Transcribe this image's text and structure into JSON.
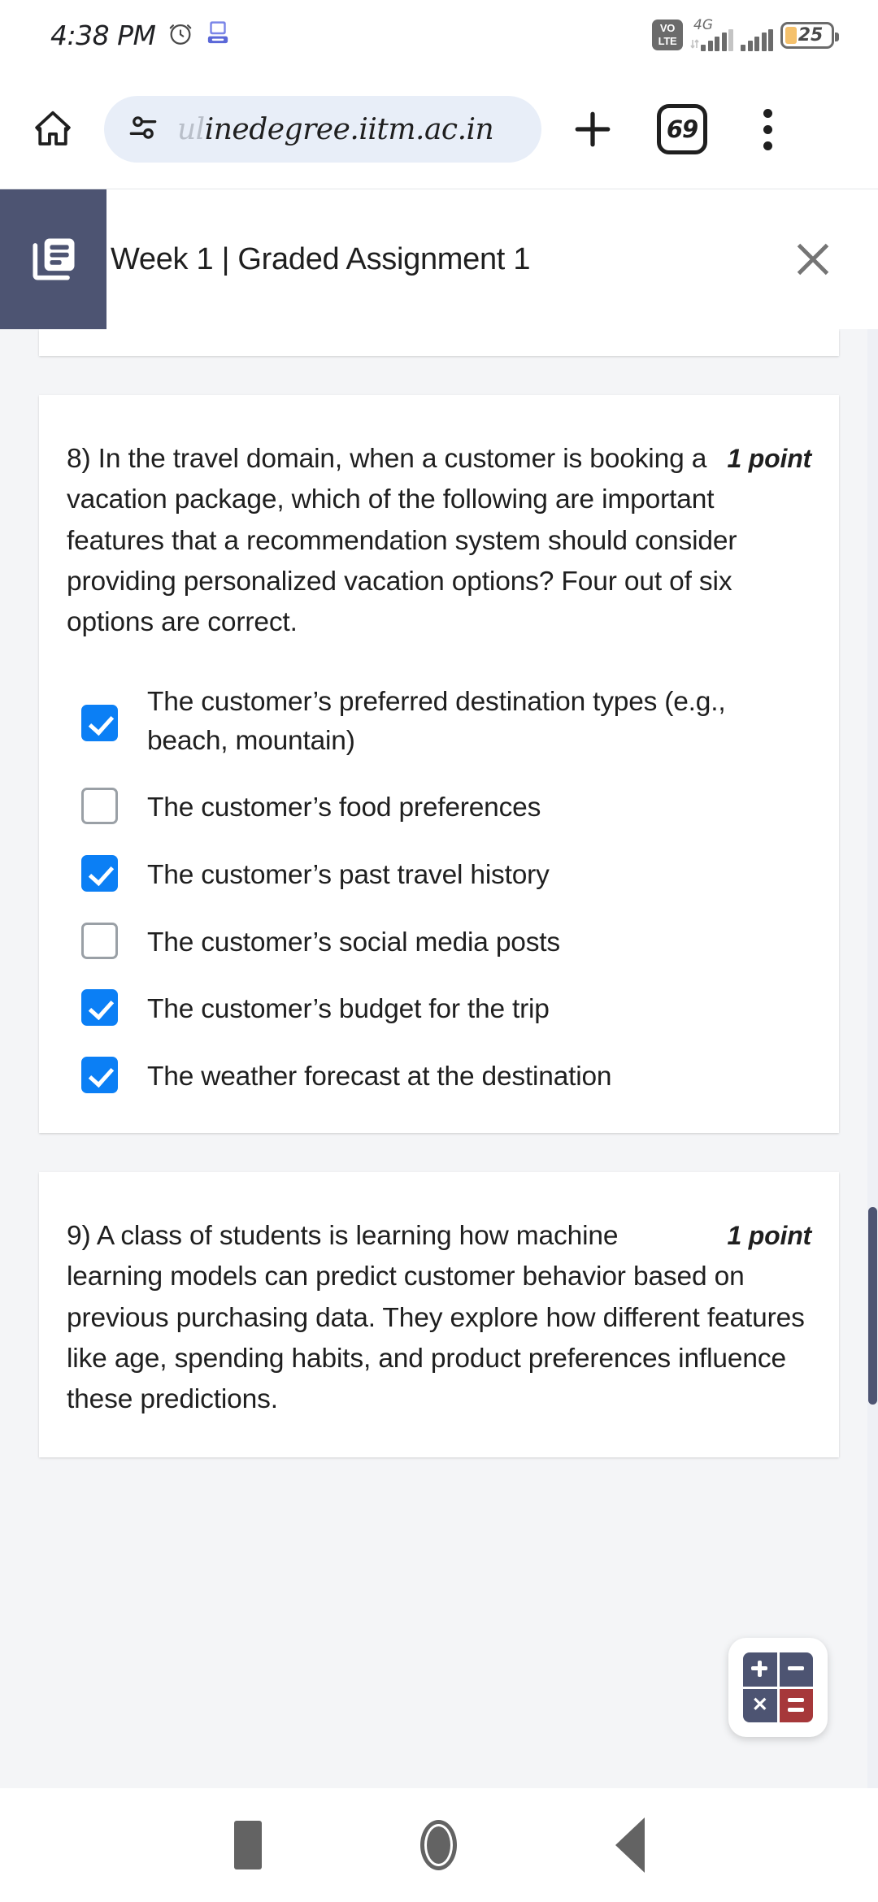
{
  "status_bar": {
    "time": "4:38 PM",
    "alarm_icon": "alarm-clock-icon",
    "mail_icon": "mail-badge-icon",
    "volte_line1": "VO",
    "volte_line2": "LTE",
    "network_type": "4G",
    "battery_percent": "25"
  },
  "browser": {
    "home_icon": "home-icon",
    "site_settings_icon": "tune-sliders-icon",
    "url_faded": "ul",
    "url_text": "inedegree.iitm.ac.in",
    "new_tab_icon": "plus-icon",
    "tab_count": "69",
    "menu_icon": "three-dot-menu-icon"
  },
  "page_header": {
    "icon": "library-article-icon",
    "title": "Week 1 | Graded Assignment 1",
    "close_icon": "close-x-icon"
  },
  "questions": [
    {
      "number": "8)",
      "points": "1 point",
      "text": "In the travel domain, when a customer is booking a vacation package, which of the following are important features that a recommendation system should consider providing personalized vacation options? Four out of six options are correct.",
      "options": [
        {
          "label": "The customer’s preferred destination types (e.g., beach, mountain)",
          "checked": true
        },
        {
          "label": "The customer’s food preferences",
          "checked": false
        },
        {
          "label": "The customer’s past travel history",
          "checked": true
        },
        {
          "label": "The customer’s social media posts",
          "checked": false
        },
        {
          "label": "The customer’s budget for the trip",
          "checked": true
        },
        {
          "label": "The weather forecast at the destination",
          "checked": true
        }
      ]
    },
    {
      "number": "9)",
      "points": "1 point",
      "text": "A class of students is learning how machine learning models can predict customer behavior based on previous purchasing data. They explore how different features like age, spending habits, and product preferences influence these predictions.",
      "options": []
    }
  ],
  "calculator_fab": {
    "name": "calculator-widget",
    "keys": [
      "plus",
      "minus",
      "multiply",
      "equals"
    ],
    "accent_dark": "#4d5472",
    "accent_red": "#a6383a"
  },
  "nav_bar": {
    "recents_icon": "recents-square-icon",
    "home_icon": "home-circle-icon",
    "back_icon": "back-triangle-icon"
  },
  "colors": {
    "header_block": "#4d5472",
    "checkbox_checked": "#0b7ff5",
    "page_background": "#f4f5f7",
    "url_pill": "#e8eef8"
  }
}
